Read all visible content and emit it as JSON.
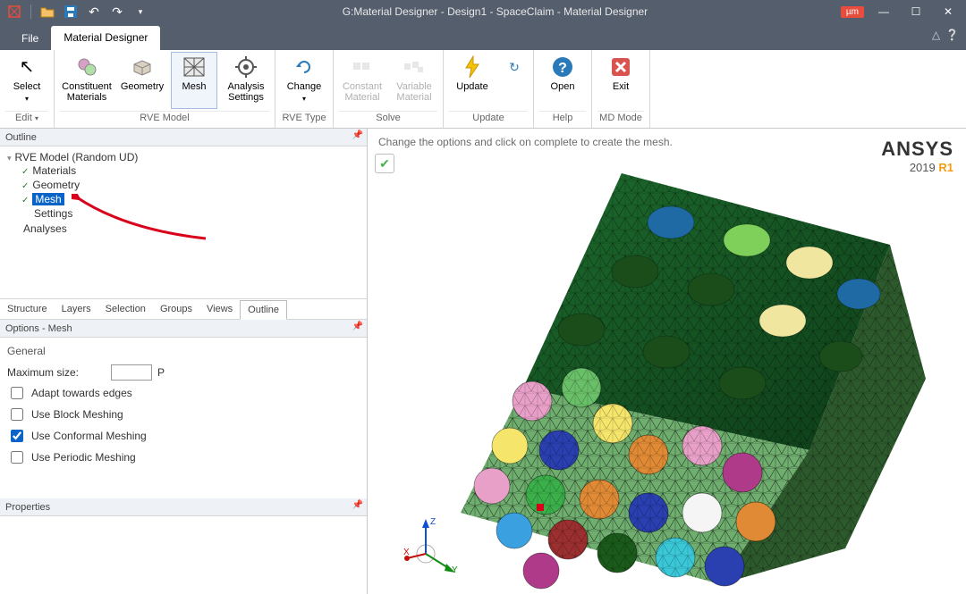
{
  "title": "G:Material Designer - Design1 - SpaceClaim - Material Designer",
  "units_badge": "µm",
  "tabs": {
    "file": "File",
    "designer": "Material Designer"
  },
  "ribbon": {
    "select": "Select",
    "edit": "Edit",
    "constituent": "Constituent\nMaterials",
    "geometry": "Geometry",
    "mesh": "Mesh",
    "analysis": "Analysis\nSettings",
    "change": "Change",
    "constant": "Constant\nMaterial",
    "variable": "Variable\nMaterial",
    "update": "Update",
    "open": "Open",
    "exit": "Exit",
    "g_rve_model": "RVE Model",
    "g_rve_type": "RVE Type",
    "g_solve": "Solve",
    "g_update": "Update",
    "g_help": "Help",
    "g_mdmode": "MD Mode"
  },
  "outline": {
    "title": "Outline",
    "root": "RVE Model (Random UD)",
    "items": [
      "Materials",
      "Geometry",
      "Mesh",
      "Settings"
    ],
    "analyses": "Analyses"
  },
  "subtabs": [
    "Structure",
    "Layers",
    "Selection",
    "Groups",
    "Views",
    "Outline"
  ],
  "options": {
    "title": "Options - Mesh",
    "general": "General",
    "maxsize_label": "Maximum size:",
    "maxsize_value": "",
    "unit_suffix": "P",
    "adapt": "Adapt towards edges",
    "block": "Use Block Meshing",
    "conformal": "Use Conformal Meshing",
    "periodic": "Use Periodic Meshing"
  },
  "properties_title": "Properties",
  "viewport": {
    "hint": "Change the options and click on complete to create the mesh.",
    "brand": "ANSYS",
    "brand_sub_year": "2019 ",
    "brand_sub_rel": "R1",
    "axis": {
      "x": "X",
      "y": "Y",
      "z": "Z"
    }
  }
}
